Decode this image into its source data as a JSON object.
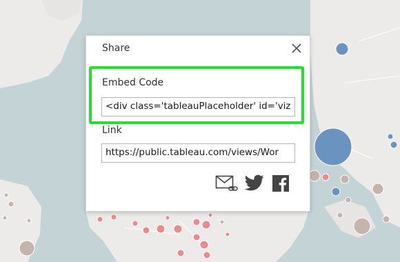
{
  "dialog": {
    "title": "Share",
    "embed": {
      "label": "Embed Code",
      "value": "<div class='tableauPlaceholder' id='viz"
    },
    "link": {
      "label": "Link",
      "value": "https://public.tableau.com/views/Wor"
    },
    "share_icons": [
      "email-icon",
      "twitter-icon",
      "facebook-icon"
    ]
  },
  "colors": {
    "highlight": "#22e02b",
    "map_water": "#c4d3d6",
    "map_land": "#ecebe9",
    "bubble_blue": "#6b93c0",
    "bubble_red": "#e98a8c",
    "bubble_gray": "#c4b4ad"
  }
}
